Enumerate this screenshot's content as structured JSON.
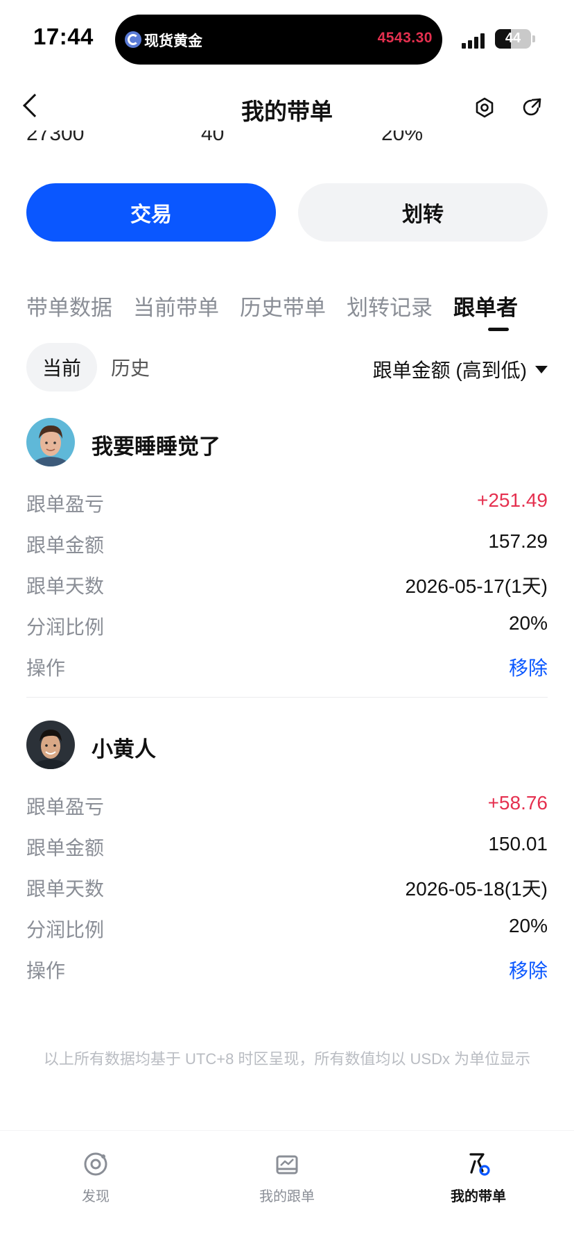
{
  "status_bar": {
    "time": "17:44",
    "island_label": "现货黄金",
    "island_price": "4543.30",
    "battery": "44",
    "battery_level": 0.44
  },
  "nav": {
    "title": "我的带单"
  },
  "stats_peek": [
    "27300",
    "40",
    "20%"
  ],
  "buttons": {
    "trade": "交易",
    "transfer": "划转"
  },
  "tabs": [
    {
      "label": "带单数据"
    },
    {
      "label": "当前带单"
    },
    {
      "label": "历史带单"
    },
    {
      "label": "划转记录"
    },
    {
      "label": "跟单者",
      "active": true
    }
  ],
  "filter": {
    "current": "当前",
    "history": "历史",
    "sort": "跟单金额 (高到低)"
  },
  "followers": [
    {
      "name": "我要睡睡觉了",
      "rows": [
        {
          "key": "跟单盈亏",
          "value": "+251.49"
        },
        {
          "key": "跟单金额",
          "value": "157.29"
        },
        {
          "key": "跟单天数",
          "value": "2026-05-17(1天)"
        },
        {
          "key": "分润比例",
          "value": "20%"
        },
        {
          "key": "操作",
          "value": "移除"
        }
      ]
    },
    {
      "name": "小黄人",
      "rows": [
        {
          "key": "跟单盈亏",
          "value": "+58.76"
        },
        {
          "key": "跟单金额",
          "value": "150.01"
        },
        {
          "key": "跟单天数",
          "value": "2026-05-18(1天)"
        },
        {
          "key": "分润比例",
          "value": "20%"
        },
        {
          "key": "操作",
          "value": "移除"
        }
      ]
    }
  ],
  "footnote": "以上所有数据均基于 UTC+8 时区呈现，所有数值均以 USDx 为单位显示",
  "tabbar": [
    {
      "label": "发现",
      "icon": "discover-icon"
    },
    {
      "label": "我的跟单",
      "icon": "copy-trade-icon"
    },
    {
      "label": "我的带单",
      "icon": "lead-trade-icon",
      "active": true
    }
  ],
  "colors": {
    "accent": "#0a57ff",
    "profit": "#e5304f",
    "muted": "#8a8e96"
  }
}
